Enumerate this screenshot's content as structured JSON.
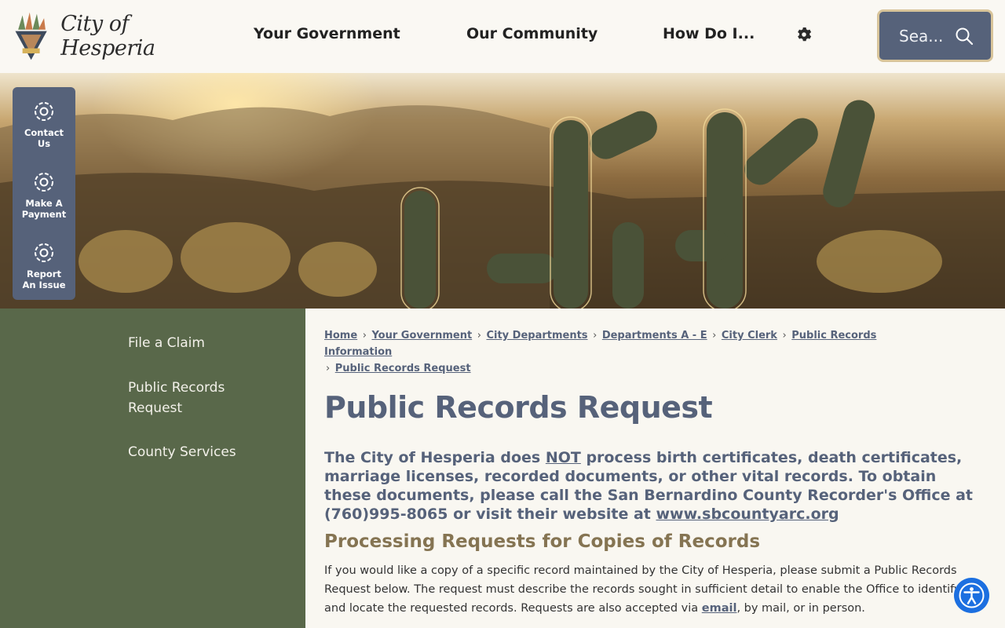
{
  "header": {
    "logo_text": "City of Hesperia",
    "nav": [
      "Your Government",
      "Our Community",
      "How Do I..."
    ],
    "search_placeholder": "Sea..."
  },
  "quick_links": [
    {
      "label_line1": "Contact",
      "label_line2": "Us",
      "icon": "gear-icon"
    },
    {
      "label_line1": "Make A",
      "label_line2": "Payment",
      "icon": "gear-icon"
    },
    {
      "label_line1": "Report",
      "label_line2": "An Issue",
      "icon": "gear-icon"
    }
  ],
  "sidebar": {
    "items": [
      {
        "line1": "File a Claim",
        "line2": ""
      },
      {
        "line1": "Public Records",
        "line2": "Request"
      },
      {
        "line1": "County Services",
        "line2": ""
      }
    ]
  },
  "breadcrumb": {
    "items": [
      "Home",
      "Your Government",
      "City Departments",
      "Departments A - E",
      "City Clerk",
      "Public Records Information",
      "Public Records Request"
    ],
    "separator": "›"
  },
  "page": {
    "title": "Public Records Request",
    "notice_part1": "The City of Hesperia does ",
    "notice_not": "NOT",
    "notice_part2": " process birth certificates, death certificates, marriage licenses, recorded documents, or other vital records. To obtain these documents, please call the San Bernardino County Recorder's Office at (760)995-8065 or visit their website at ",
    "notice_link": "www.sbcountyarc.org",
    "subhead": "Processing Requests for Copies of Records",
    "body_part1": "If you would like a copy of a specific record maintained by the City of Hesperia, please submit a Public Records Request below. The request must describe the records sought in sufficient detail to enable the Office to identify and locate the requested records. Requests are also accepted via ",
    "body_link": "email",
    "body_part2": ", by mail, or in person."
  },
  "colors": {
    "slate": "#56627a",
    "sidebar_green": "#59684a",
    "gold_border": "#d8c49a",
    "subhead_brown": "#857452",
    "accessibility_blue": "#1c6fe0"
  }
}
